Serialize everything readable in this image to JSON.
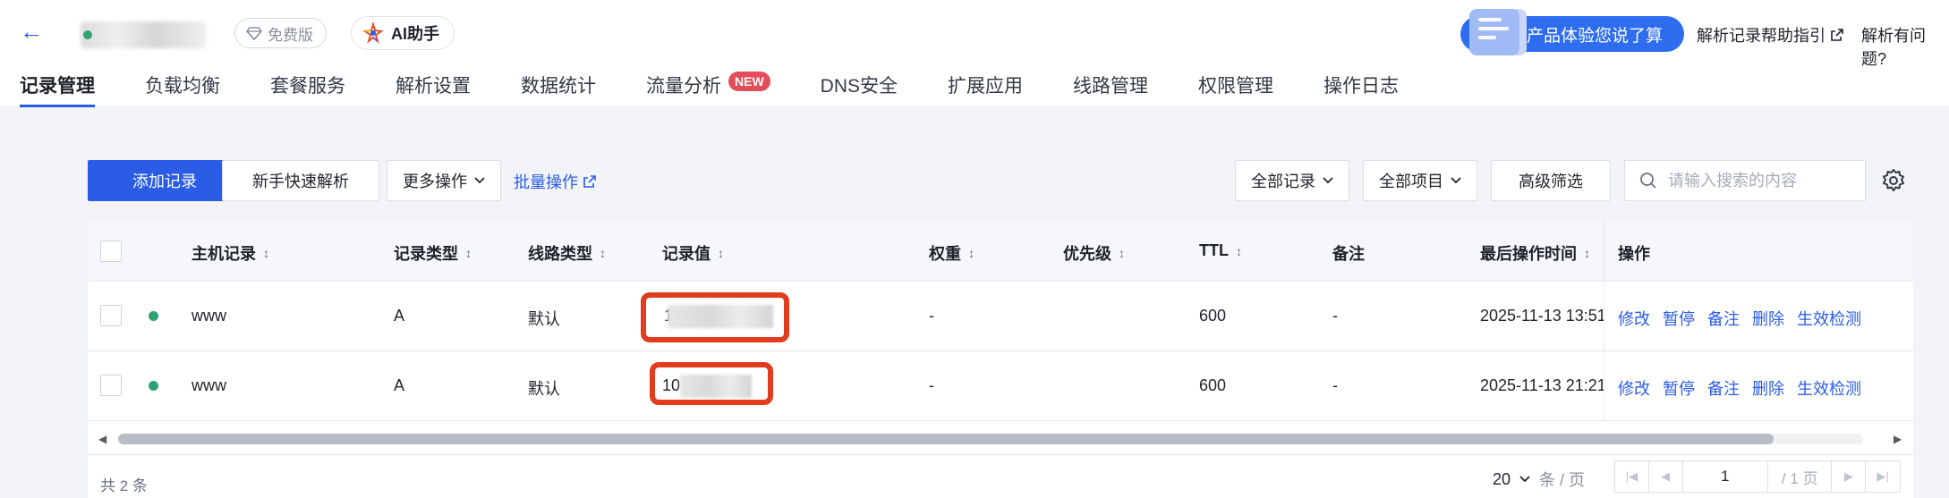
{
  "header": {
    "back_icon": "arrow-left-icon",
    "free_badge": "免费版",
    "ai_label": "AI助手",
    "promo_label": "产品体验您说了算",
    "help_link_1": "解析记录帮助指引",
    "help_link_2": "解析有问题?"
  },
  "tabs": [
    {
      "label": "记录管理",
      "active": true
    },
    {
      "label": "负载均衡"
    },
    {
      "label": "套餐服务"
    },
    {
      "label": "解析设置"
    },
    {
      "label": "数据统计"
    },
    {
      "label": "流量分析",
      "badge": "NEW"
    },
    {
      "label": "DNS安全"
    },
    {
      "label": "扩展应用"
    },
    {
      "label": "线路管理"
    },
    {
      "label": "权限管理"
    },
    {
      "label": "操作日志"
    }
  ],
  "toolbar": {
    "add_record": "添加记录",
    "quick_resolve": "新手快速解析",
    "more_ops": "更多操作",
    "batch_ops": "批量操作",
    "all_records": "全部记录",
    "all_projects": "全部项目",
    "advanced_filter": "高级筛选",
    "search_placeholder": "请输入搜索的内容"
  },
  "table": {
    "columns": [
      "主机记录",
      "记录类型",
      "线路类型",
      "记录值",
      "权重",
      "优先级",
      "TTL",
      "备注",
      "最后操作时间",
      "操作"
    ],
    "rows": [
      {
        "host": "www",
        "type": "A",
        "line": "默认",
        "value_prefix": "1",
        "weight": "-",
        "priority": "",
        "ttl": "600",
        "remark": "-",
        "time": "2025-11-13 13:51"
      },
      {
        "host": "www",
        "type": "A",
        "line": "默认",
        "value_prefix": "10",
        "weight": "-",
        "priority": "",
        "ttl": "600",
        "remark": "-",
        "time": "2025-11-13 21:21"
      }
    ],
    "actions": [
      "修改",
      "暂停",
      "备注",
      "删除",
      "生效检测"
    ]
  },
  "footer": {
    "total": "共 2 条",
    "page_size": "20",
    "page_size_unit": "条 / 页",
    "current_page": "1",
    "total_pages": "/ 1 页"
  },
  "colors": {
    "primary": "#2b5ce6",
    "status_ok": "#2ba471",
    "highlight_box": "#e03c1d",
    "new_badge": "#e34d59"
  }
}
